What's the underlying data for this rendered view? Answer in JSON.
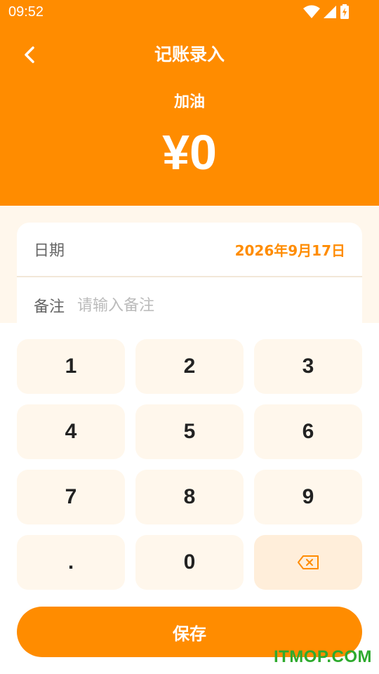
{
  "status_bar": {
    "time": "09:52",
    "icons": [
      "wifi-icon",
      "signal-icon",
      "battery-charging-icon"
    ]
  },
  "header": {
    "title": "记账录入",
    "category": "加油",
    "amount": "¥0",
    "back_icon": "chevron-left-icon"
  },
  "form": {
    "date_label": "日期",
    "date_value": "2026年9月17日",
    "note_label": "备注",
    "note_placeholder": "请输入备注",
    "note_value": ""
  },
  "keypad": {
    "keys": [
      "1",
      "2",
      "3",
      "4",
      "5",
      "6",
      "7",
      "8",
      "9",
      ".",
      "0"
    ],
    "delete_icon": "backspace-icon"
  },
  "save_label": "保存",
  "watermark": "ITMOP.COM",
  "colors": {
    "accent": "#FF8C00",
    "key_bg": "#FFF7EC",
    "delete_key_bg": "#FFEEDA",
    "watermark": "#2EAA2E"
  }
}
